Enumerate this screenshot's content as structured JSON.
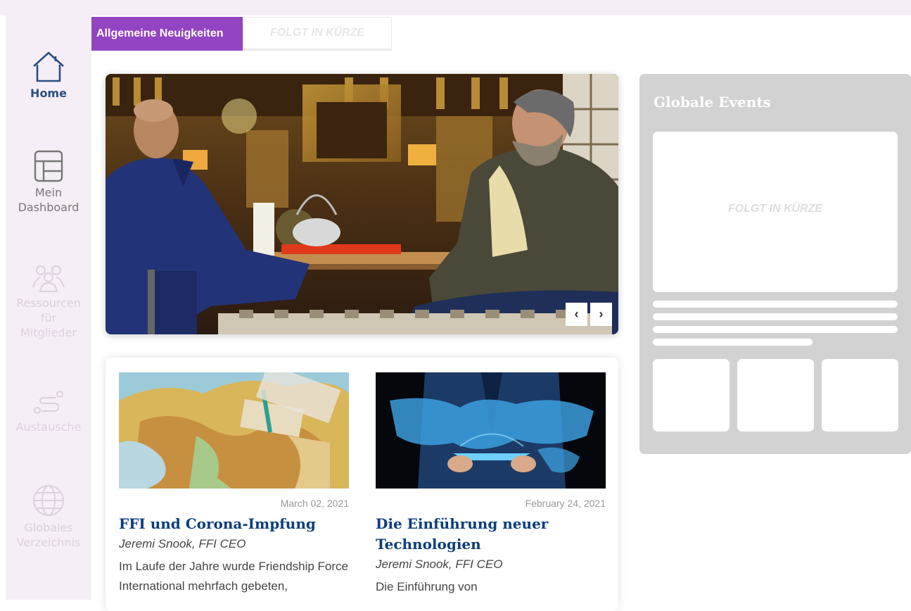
{
  "sidebar": {
    "items": [
      {
        "label": "Home",
        "icon": "home-icon",
        "state": "active"
      },
      {
        "label": "Mein Dashboard",
        "icon": "dashboard-icon",
        "state": "normal"
      },
      {
        "label": "Ressourcen für Mitglieder",
        "icon": "members-icon",
        "state": "disabled"
      },
      {
        "label": "Austausche",
        "icon": "route-icon",
        "state": "disabled"
      },
      {
        "label": "Globales Verzeichnis",
        "icon": "globe-icon",
        "state": "disabled"
      }
    ]
  },
  "tabs": {
    "active": "Allgemeine Neuigkeiten",
    "coming_soon": "FOLGT IN KÜRZE"
  },
  "hero": {
    "prev_icon": "chevron-left-icon",
    "next_icon": "chevron-right-icon",
    "prev_glyph": "‹",
    "next_glyph": "›"
  },
  "events": {
    "title": "Globale Events",
    "coming_soon": "FOLGT IN KÜRZE"
  },
  "news": {
    "articles": [
      {
        "date": "March 02, 2021",
        "title": "FFI und Corona-Impfung",
        "author": "Jeremi Snook, FFI CEO",
        "excerpt": "Im Laufe der Jahre wurde Friendship Force International mehrfach gebeten,"
      },
      {
        "date": "February 24, 2021",
        "title": "Die Einführung neuer Technologien",
        "author": "Jeremi Snook, FFI CEO",
        "excerpt": "Die Einführung von"
      }
    ]
  },
  "colors": {
    "sidebar_bg": "#f6eef7",
    "tab_active": "#9244c2",
    "home_active": "#2b4f7e",
    "article_title": "#0c3e7d",
    "events_panel": "#d2d2d2"
  }
}
